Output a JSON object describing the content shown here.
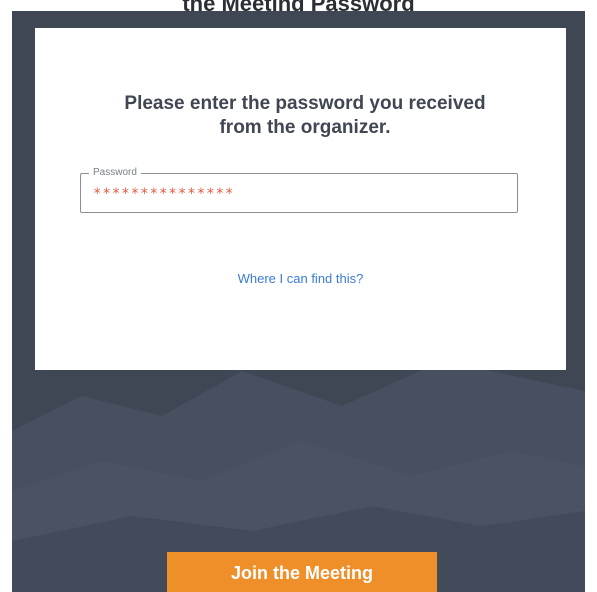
{
  "header": {
    "title": "the Meeting Password"
  },
  "dialog": {
    "prompt": "Please enter the password you received from the organizer.",
    "password_field": {
      "label": "Password",
      "value": "***************"
    },
    "help_link": "Where I can find this?"
  },
  "footer": {
    "join_button_label": "Join the Meeting"
  },
  "colors": {
    "background": "#3f4654",
    "card": "#ffffff",
    "accent_button": "#ef8f2a",
    "link": "#3b7ad6",
    "password_text": "#e05a44"
  }
}
